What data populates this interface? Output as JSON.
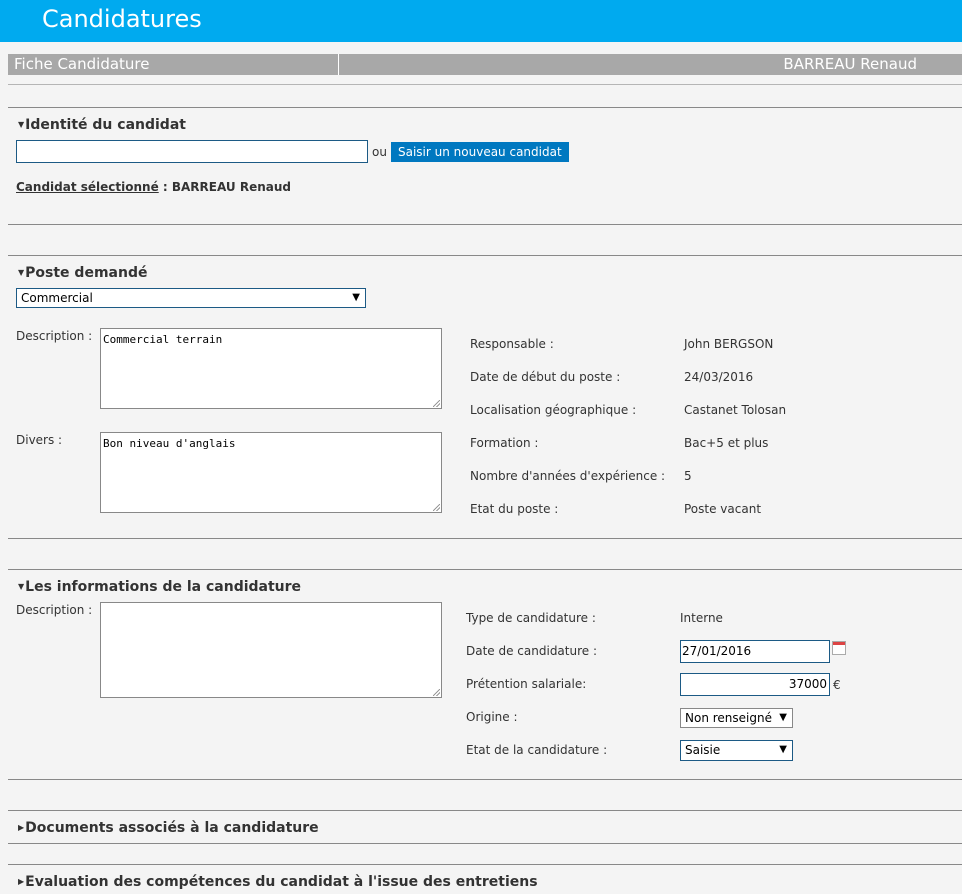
{
  "app": {
    "title": "Candidatures"
  },
  "header": {
    "left": "Fiche Candidature",
    "right": "BARREAU Renaud"
  },
  "identite": {
    "section_title": "Identité du candidat",
    "search_value": "",
    "or_text": "ou",
    "new_button": "Saisir un nouveau candidat",
    "selected_label": "Candidat sélectionné",
    "selected_sep": " : ",
    "selected_value": "BARREAU Renaud"
  },
  "poste": {
    "section_title": "Poste demandé",
    "select_value": "Commercial",
    "description_label": "Description :",
    "description_value": "Commercial terrain",
    "divers_label": "Divers :",
    "divers_value": "Bon niveau d'anglais",
    "details": [
      {
        "label": "Responsable :",
        "value": "John BERGSON"
      },
      {
        "label": "Date de début du poste :",
        "value": "24/03/2016"
      },
      {
        "label": "Localisation géographique :",
        "value": "Castanet Tolosan"
      },
      {
        "label": "Formation :",
        "value": "Bac+5 et plus"
      },
      {
        "label": "Nombre d'années d'expérience :",
        "value": "5"
      },
      {
        "label": "Etat du poste :",
        "value": "Poste vacant"
      }
    ]
  },
  "candidature": {
    "section_title": "Les informations de la candidature",
    "description_label": "Description :",
    "description_value": "",
    "type_label": "Type de candidature :",
    "type_value": "Interne",
    "date_label": "Date de candidature :",
    "date_value": "27/01/2016",
    "pretention_label": "Prétention salariale:",
    "pretention_value": "37000",
    "currency": "€",
    "origine_label": "Origine :",
    "origine_value": "Non renseigné",
    "etat_label": "Etat de la candidature :",
    "etat_value": "Saisie"
  },
  "documents": {
    "section_title": "Documents associés à la candidature"
  },
  "evaluation": {
    "section_title": "Evaluation des compétences du candidat à l'issue des entretiens"
  }
}
